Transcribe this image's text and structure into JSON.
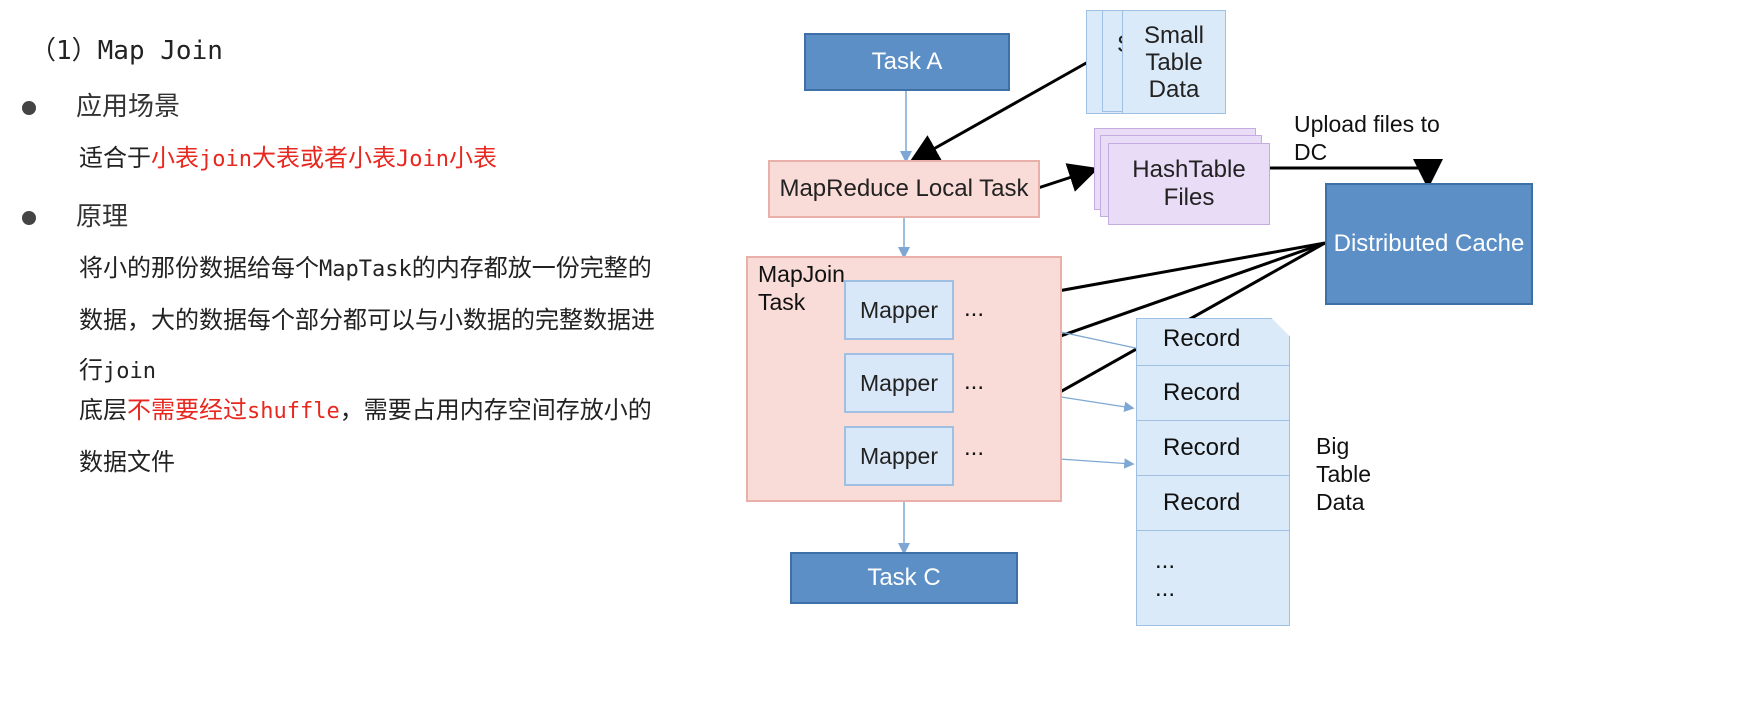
{
  "left": {
    "title": "（1）Map Join",
    "bullet1": "应用场景",
    "scene_prefix": "适合于",
    "scene_red_1": "小表",
    "scene_red_join1": "join",
    "scene_red_2": "大表或者小表",
    "scene_red_join2": "Join",
    "scene_red_3": "小表",
    "bullet2": "原理",
    "p1_a": "将小的那份数据给每个",
    "p1_maptask": "MapTask",
    "p1_b": "的内存都放一份完整的",
    "p1_line2": "数据，大的数据每个部分都可以与小数据的完整数据进",
    "p1_line3_a": "行",
    "p1_line3_join": "join",
    "p2_a": "底层",
    "p2_red": "不需要经过",
    "p2_red_mono": "shuffle",
    "p2_b": "，需要占用内存空间存放小的",
    "p2_line2": "数据文件"
  },
  "diagram": {
    "task_a": "Task A",
    "small_table_back": "S",
    "small_table": [
      "Small",
      "Table",
      "Data"
    ],
    "local_task": "MapReduce Local Task",
    "hashtable": [
      "HashTable",
      "Files"
    ],
    "upload": [
      "Upload files to",
      "DC"
    ],
    "dist_cache": "Distributed Cache",
    "mapjoin_task": [
      "MapJoin",
      "Task"
    ],
    "mapper": "Mapper",
    "ellipsis": "...",
    "records": [
      "Record",
      "Record",
      "Record",
      "Record",
      "...",
      "..."
    ],
    "big_table": [
      "Big",
      "Table",
      "Data"
    ],
    "task_c": "Task C"
  },
  "colors": {
    "accent_red": "#e8271f",
    "task_blue": "#5b8fc6",
    "local_pink": "#f9dcd8",
    "hash_purple": "#e9dcf6",
    "record_blue": "#dbeaf9"
  }
}
